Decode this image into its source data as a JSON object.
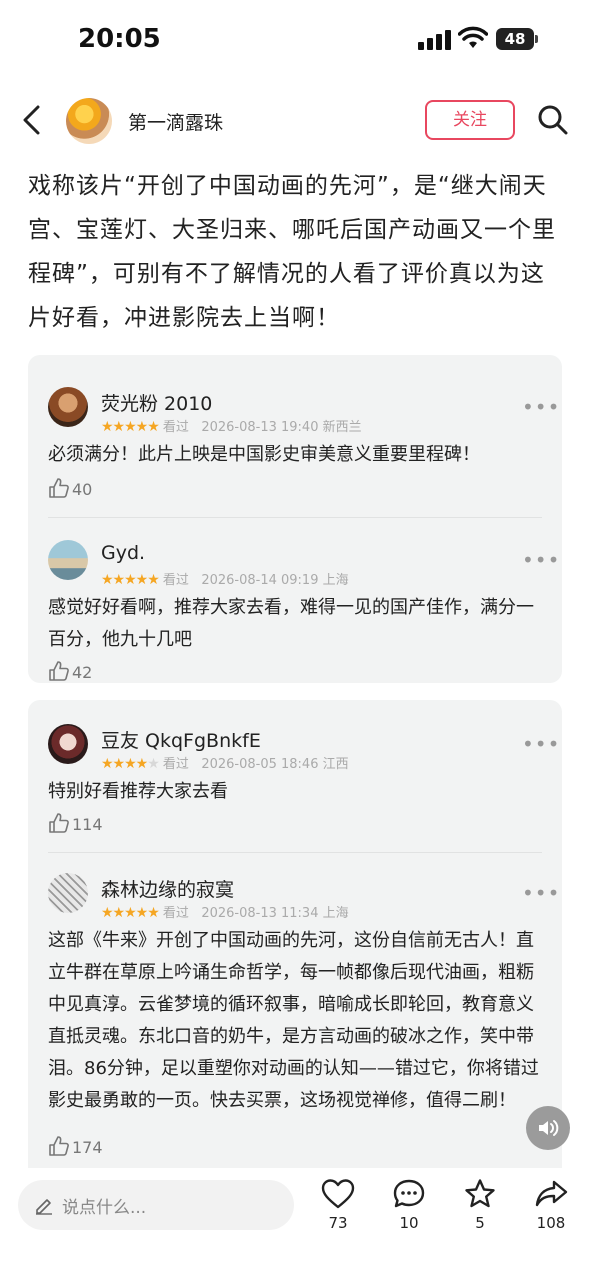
{
  "status": {
    "time": "20:05",
    "battery": "48"
  },
  "header": {
    "author": "第一滴露珠",
    "follow_label": "关注"
  },
  "post": {
    "text": "戏称该片“开创了中国动画的先河”，是“继大闹天宫、宝莲灯、大圣归来、哪吒后国产动画又一个里程碑”，可别有不了解情况的人看了评价真以为这片好看，冲进影院去上当啊！"
  },
  "comment_groups": [
    {
      "comments": [
        {
          "user": "荧光粉 2010",
          "stars": 5,
          "seen": "看过",
          "date": "2026-08-13 19:40",
          "location": "新西兰",
          "text": "必须满分！此片上映是中国影史审美意义重要里程碑！",
          "likes": "40"
        },
        {
          "user": "Gyd.",
          "stars": 5,
          "seen": "看过",
          "date": "2026-08-14 09:19",
          "location": "上海",
          "text": "感觉好好看啊，推荐大家去看，难得一见的国产佳作，满分一百分，他九十几吧",
          "likes": "42"
        }
      ]
    },
    {
      "comments": [
        {
          "user": "豆友 QkqFgBnkfE",
          "stars": 4,
          "seen": "看过",
          "date": "2026-08-05 18:46",
          "location": "江西",
          "text": "特别好看推荐大家去看",
          "likes": "114"
        },
        {
          "user": "森林边缘的寂寞",
          "stars": 5,
          "seen": "看过",
          "date": "2026-08-13 11:34",
          "location": "上海",
          "text": "这部《牛来》开创了中国动画的先河，这份自信前无古人！直立牛群在草原上吟诵生命哲学，每一帧都像后现代油画，粗粝中见真淳。云雀梦境的循环叙事，暗喻成长即轮回，教育意义直抵灵魂。东北口音的奶牛，是方言动画的破冰之作，笑中带泪。86分钟，足以重塑你对动画的认知——错过它，你将错过影史最勇敢的一页。快去买票，这场视觉禅修，值得二刷！",
          "likes": "174"
        }
      ]
    }
  ],
  "bottom": {
    "input_placeholder": "说点什么...",
    "likes": "73",
    "comments": "10",
    "favorites": "5",
    "shares": "108"
  },
  "icons": [
    "back-icon",
    "search-icon",
    "more-icon",
    "thumb-up-icon",
    "heart-icon",
    "comment-icon",
    "star-icon",
    "share-icon",
    "pen-icon",
    "speaker-icon"
  ]
}
